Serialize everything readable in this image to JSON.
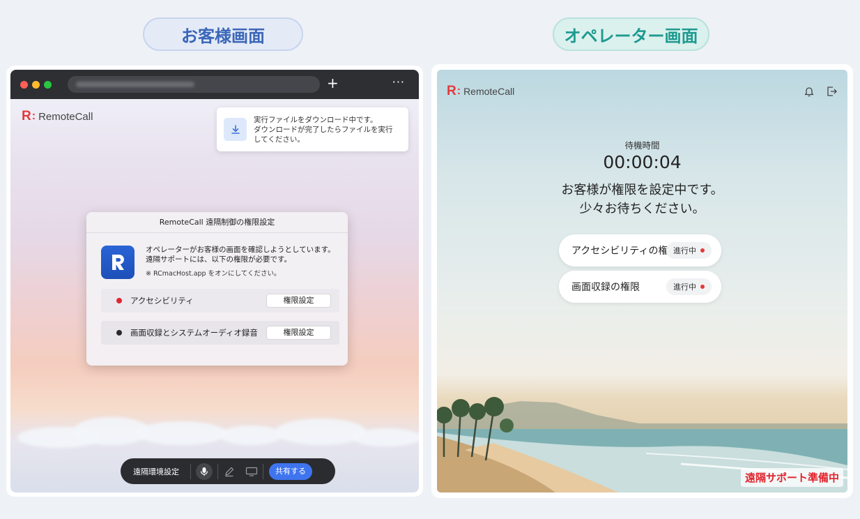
{
  "labels": {
    "customer_screen": "お客様画面",
    "operator_screen": "オペレーター画面"
  },
  "customer": {
    "brand": {
      "r": "R",
      "colon": ":",
      "name": "RemoteCall"
    },
    "browser_bar": {
      "plus": "+",
      "more": "···"
    },
    "toast": {
      "text_line1": "実行ファイルをダウンロード中です。",
      "text_line2": "ダウンロードが完了したらファイルを実行",
      "text_line3": "してください。",
      "icon": "download-icon"
    },
    "dialog": {
      "title": "RemoteCall 遠隔制御の権限設定",
      "message_line1": "オペレーターがお客様の画面を確認しようとしています。",
      "message_line2": "遠隔サポートには、以下の権限が必要です。",
      "note": "※ RCmacHost.app をオンにしてください。",
      "permissions": [
        {
          "label": "アクセシビリティ",
          "button": "権限設定",
          "status_color": "#e0262f"
        },
        {
          "label": "画面収録とシステムオーディオ録音",
          "button": "権限設定",
          "status_color": "#2a2a2a"
        }
      ]
    },
    "toolbar": {
      "settings_label": "遠隔環境設定",
      "share_label": "共有する",
      "icons": [
        "microphone-icon",
        "pen-icon",
        "screen-icon"
      ]
    }
  },
  "operator": {
    "brand": {
      "r": "R",
      "colon": ":",
      "name": "RemoteCall"
    },
    "icons": [
      "bell-icon",
      "logout-icon"
    ],
    "wait_label": "待機時間",
    "timer": "00:00:04",
    "message_line1": "お客様が権限を設定中です。",
    "message_line2": "少々お待ちください。",
    "statuses": [
      {
        "label": "アクセシビリティの権限",
        "badge": "進行中"
      },
      {
        "label": "画面収録の権限",
        "badge": "進行中"
      }
    ],
    "footer_status": "遠隔サポート準備中"
  },
  "colors": {
    "accent_red": "#e23a3a",
    "share_blue": "#3f74ef",
    "customer_pill": "#3a66b8",
    "operator_pill": "#1e9a8f"
  }
}
